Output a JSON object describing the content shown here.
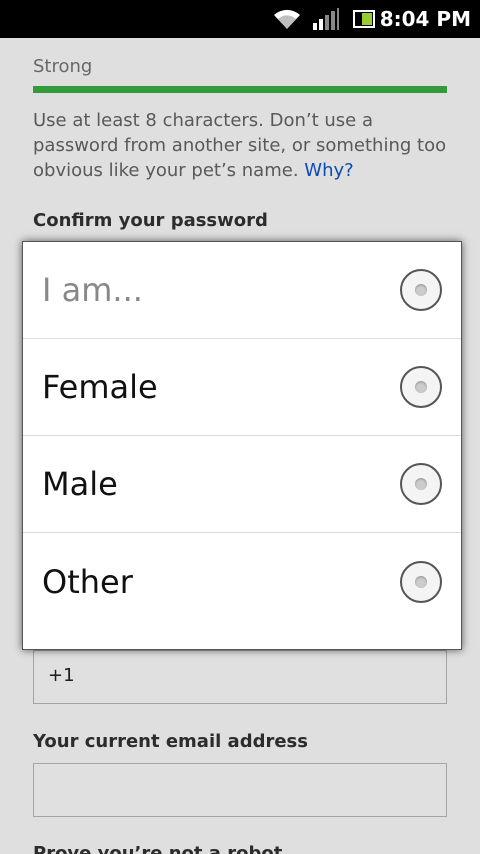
{
  "status_bar": {
    "time": "8:04 PM"
  },
  "form": {
    "strength_label": "Strong",
    "password_help": "Use at least 8 characters. Don’t use a password from another site, or something too obvious like your pet’s name.",
    "password_help_link": "Why?",
    "confirm_password_label": "Confirm your password",
    "phone_value": "+1",
    "email_label": "Your current email address",
    "email_value": "",
    "robot_label": "Prove you’re not a robot"
  },
  "gender_dialog": {
    "options": [
      {
        "label": "I am...",
        "selected": false
      },
      {
        "label": "Female",
        "selected": false
      },
      {
        "label": "Male",
        "selected": false
      },
      {
        "label": "Other",
        "selected": false
      }
    ]
  }
}
